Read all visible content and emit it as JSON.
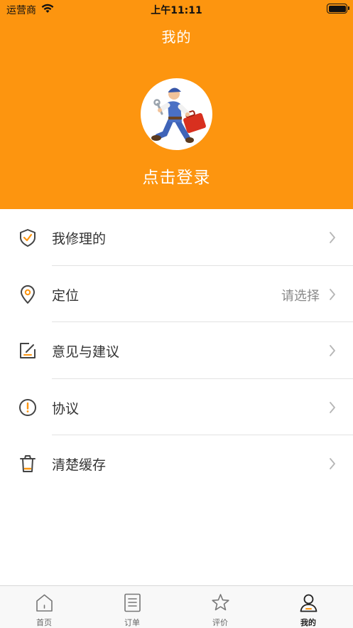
{
  "status_bar": {
    "carrier": "运营商",
    "time": "上午11:11"
  },
  "header": {
    "title": "我的",
    "login_text": "点击登录",
    "background_color": "#fd950f"
  },
  "menu": {
    "items": [
      {
        "label": "我修理的",
        "value": "",
        "icon": "shield-check-icon"
      },
      {
        "label": "定位",
        "value": "请选择",
        "icon": "location-pin-icon"
      },
      {
        "label": "意见与建议",
        "value": "",
        "icon": "edit-note-icon"
      },
      {
        "label": "协议",
        "value": "",
        "icon": "exclamation-circle-icon"
      },
      {
        "label": "清楚缓存",
        "value": "",
        "icon": "trash-icon"
      }
    ]
  },
  "tabbar": {
    "tabs": [
      {
        "label": "首页",
        "icon": "home-icon",
        "active": false
      },
      {
        "label": "订单",
        "icon": "document-icon",
        "active": false
      },
      {
        "label": "评价",
        "icon": "star-icon",
        "active": false
      },
      {
        "label": "我的",
        "icon": "user-icon",
        "active": true
      }
    ]
  },
  "colors": {
    "accent": "#fd950f",
    "icon_stroke": "#444444"
  }
}
